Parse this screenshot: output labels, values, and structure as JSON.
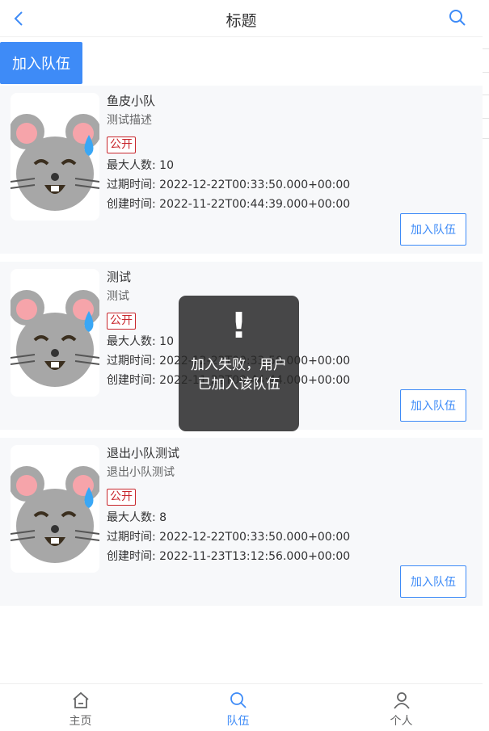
{
  "navbar": {
    "title": "标题",
    "back_icon": "chevron-left-icon",
    "search_icon": "search-icon"
  },
  "top_action": {
    "join_label": "加入队伍"
  },
  "teams": [
    {
      "name": "鱼皮小队",
      "description": "测试描述",
      "tag": "公开",
      "max_members": "最大人数: 10",
      "expire": "过期时间: 2022-12-22T00:33:50.000+00:00",
      "created": "创建时间: 2022-11-22T00:44:39.000+00:00",
      "join_label": "加入队伍"
    },
    {
      "name": "测试",
      "description": "测试",
      "tag": "公开",
      "max_members": "最大人数: 10",
      "expire": "过期时间: 2022-12-22T00:33:50.000+00:00",
      "created": "创建时间: 2022-11-22T00:44:44.000+00:00",
      "join_label": "加入队伍"
    },
    {
      "name": "退出小队测试",
      "description": "退出小队测试",
      "tag": "公开",
      "max_members": "最大人数: 8",
      "expire": "过期时间: 2022-12-22T00:33:50.000+00:00",
      "created": "创建时间: 2022-11-23T13:12:56.000+00:00",
      "join_label": "加入队伍"
    }
  ],
  "toast": {
    "icon": "!",
    "message": "加入失败，用户已加入该队伍"
  },
  "tabbar": {
    "items": [
      {
        "label": "主页",
        "icon": "home-icon",
        "active": false
      },
      {
        "label": "队伍",
        "icon": "search-icon",
        "active": true
      },
      {
        "label": "个人",
        "icon": "user-icon",
        "active": false
      }
    ]
  },
  "colors": {
    "primary": "#3e8bf7",
    "tag_red": "#c8262c",
    "card_bg": "#f7f8fa"
  }
}
